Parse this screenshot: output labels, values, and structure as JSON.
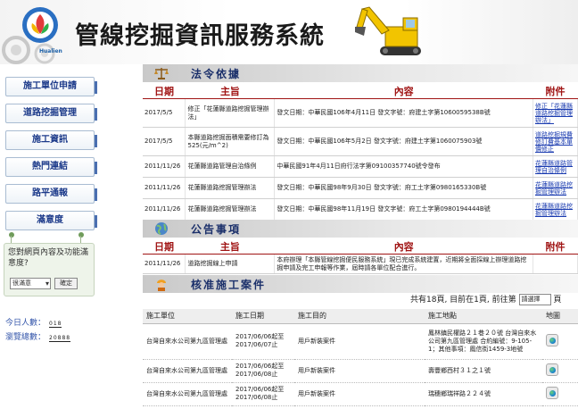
{
  "header": {
    "logo_text": "Hualien",
    "site_title": "管線挖掘資訊服務系統"
  },
  "sidebar": {
    "nav": [
      {
        "label": "施工單位申請"
      },
      {
        "label": "道路挖掘管理"
      },
      {
        "label": "施工資訊"
      },
      {
        "label": "熱門連結"
      },
      {
        "label": "路平通報"
      },
      {
        "label": "滿意度"
      }
    ],
    "poll": {
      "question": "您對網頁內容及功能滿意度?",
      "selected": "很滿意",
      "submit_label": "確定"
    },
    "counters": [
      {
        "label": "今日人數：",
        "value": "018"
      },
      {
        "label": "瀏覽總數：",
        "value": "20888"
      }
    ]
  },
  "regulations": {
    "title": "法令依據",
    "columns": [
      "日期",
      "主旨",
      "內容",
      "附件"
    ],
    "rows": [
      {
        "date": "2017/5/5",
        "subject": "修正「花蓮縣道路挖掘管理辦法」",
        "content": "發文日期：中華民國106年4月11日 發文字號：府建土字第1060059538B號",
        "attachment": "修正「花蓮縣道路挖掘管理辦法」"
      },
      {
        "date": "2017/5/5",
        "subject": "本縣道路挖掘面積需要修訂為525(元/m^2)",
        "content": "發文日期：中華民國106年5月2日 發文字號：府建土字第1060075903號",
        "attachment": "道路挖掘規費修訂費基本單價修正"
      },
      {
        "date": "2011/11/26",
        "subject": "花蓮縣道路管理自治條例",
        "content": "中華民國91年4月11日府行法字第09100357740號令發布",
        "attachment": "花蓮縣道路管理自治條例"
      },
      {
        "date": "2011/11/26",
        "subject": "花蓮縣道路挖掘管理辦法",
        "content": "發文日期：中華民國98年9月30日 發文字號：府工土字第0980165330B號",
        "attachment": "花蓮縣道路挖掘管理辦法"
      },
      {
        "date": "2011/11/26",
        "subject": "花蓮縣道路挖掘管理辦法",
        "content": "發文日期：中華民國98年11月19日 發文字號：府工土字第0980194444B號",
        "attachment": "花蓮縣道路挖掘管理辦法"
      }
    ]
  },
  "announcements": {
    "title": "公告事項",
    "columns": [
      "日期",
      "主旨",
      "內容",
      "附件"
    ],
    "rows": [
      {
        "date": "2011/11/26",
        "subject": "道路挖掘線上申請",
        "content": "本府辦理「本縣管線挖掘便民服務系統」現已完成系統建置，近期將全面採線上辦理道路挖掘申請及完工申報等作業，屆時請各單位配合進行。",
        "attachment": ""
      }
    ]
  },
  "cases": {
    "title": "核准施工案件",
    "paging": {
      "text": "共有18頁, 目前在1頁, 前往第",
      "select": "請選擇",
      "suffix": "頁"
    },
    "columns": [
      "施工單位",
      "施工日期",
      "施工目的",
      "施工地點",
      "地圖"
    ],
    "rows": [
      {
        "unit": "台灣自來水公司第九區管理處",
        "date": "2017/06/06起至2017/06/07止",
        "purpose": "用戶新裝案件",
        "location": "鳳林鎮民權路２１巷２０號 台灣自來水公司第九區管理處 合約編號：9-105-1；其他事項：鳳信街1459-3地號"
      },
      {
        "unit": "台灣自來水公司第九區管理處",
        "date": "2017/06/06起至2017/06/08止",
        "purpose": "用戶新裝案件",
        "location": "壽豐鄉西村３１之１號"
      },
      {
        "unit": "台灣自來水公司第九區管理處",
        "date": "2017/06/06起至2017/06/08止",
        "purpose": "用戶新裝案件",
        "location": "瑞穗鄉瑞祥路２２４號"
      }
    ]
  }
}
